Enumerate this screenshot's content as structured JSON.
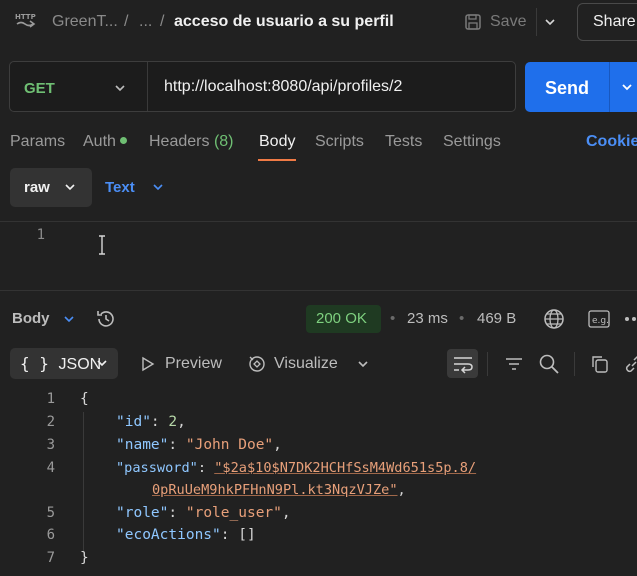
{
  "header": {
    "app_icon": "http-icon",
    "breadcrumb_workspace": "GreenT...",
    "breadcrumb_sep1": "/",
    "breadcrumb_ellipsis": "...",
    "breadcrumb_sep2": "/",
    "title": "acceso de usuario a su perfil",
    "save_label": "Save",
    "share_label": "Share"
  },
  "request": {
    "method": "GET",
    "url": "http://localhost:8080/api/profiles/2",
    "send_label": "Send"
  },
  "tabs": {
    "params": "Params",
    "auth": "Auth",
    "headers": "Headers",
    "headers_count": "(8)",
    "body": "Body",
    "scripts": "Scripts",
    "tests": "Tests",
    "settings": "Settings",
    "cookies": "Cookie"
  },
  "body_type": {
    "mode": "raw",
    "format": "Text"
  },
  "request_editor": {
    "line_numbers": [
      "1"
    ]
  },
  "response": {
    "label": "Body",
    "status": "200 OK",
    "time": "23 ms",
    "size": "469 B",
    "view_mode": "JSON",
    "view_icon": "{ }",
    "preview_label": "Preview",
    "visualize_label": "Visualize",
    "lines": [
      {
        "n": "1",
        "open_brace": "{"
      },
      {
        "n": "2",
        "key": "\"id\"",
        "value": "2",
        "trail": ","
      },
      {
        "n": "3",
        "key": "\"name\"",
        "value": "\"John Doe\"",
        "trail": ","
      },
      {
        "n": "4",
        "key": "\"password\"",
        "value": "\"$2a$10$N7DK2HCHfSsM4Wd651s5p.8/",
        "cont": "0pRuUeM9hkPFHnN9Pl.kt3NqzVJZe\"",
        "trail": ","
      },
      {
        "n": "5",
        "key": "\"role\"",
        "value": "\"role_user\"",
        "trail": ","
      },
      {
        "n": "6",
        "key": "\"ecoActions\"",
        "value": "[]"
      },
      {
        "n": "7",
        "close_brace": "}"
      }
    ]
  },
  "colors": {
    "accent_blue": "#1f6feb",
    "method_green": "#6fbf73",
    "active_tab_underline": "#ef7a45",
    "string_value": "#e8a07a",
    "json_key": "#8fc7ff"
  }
}
